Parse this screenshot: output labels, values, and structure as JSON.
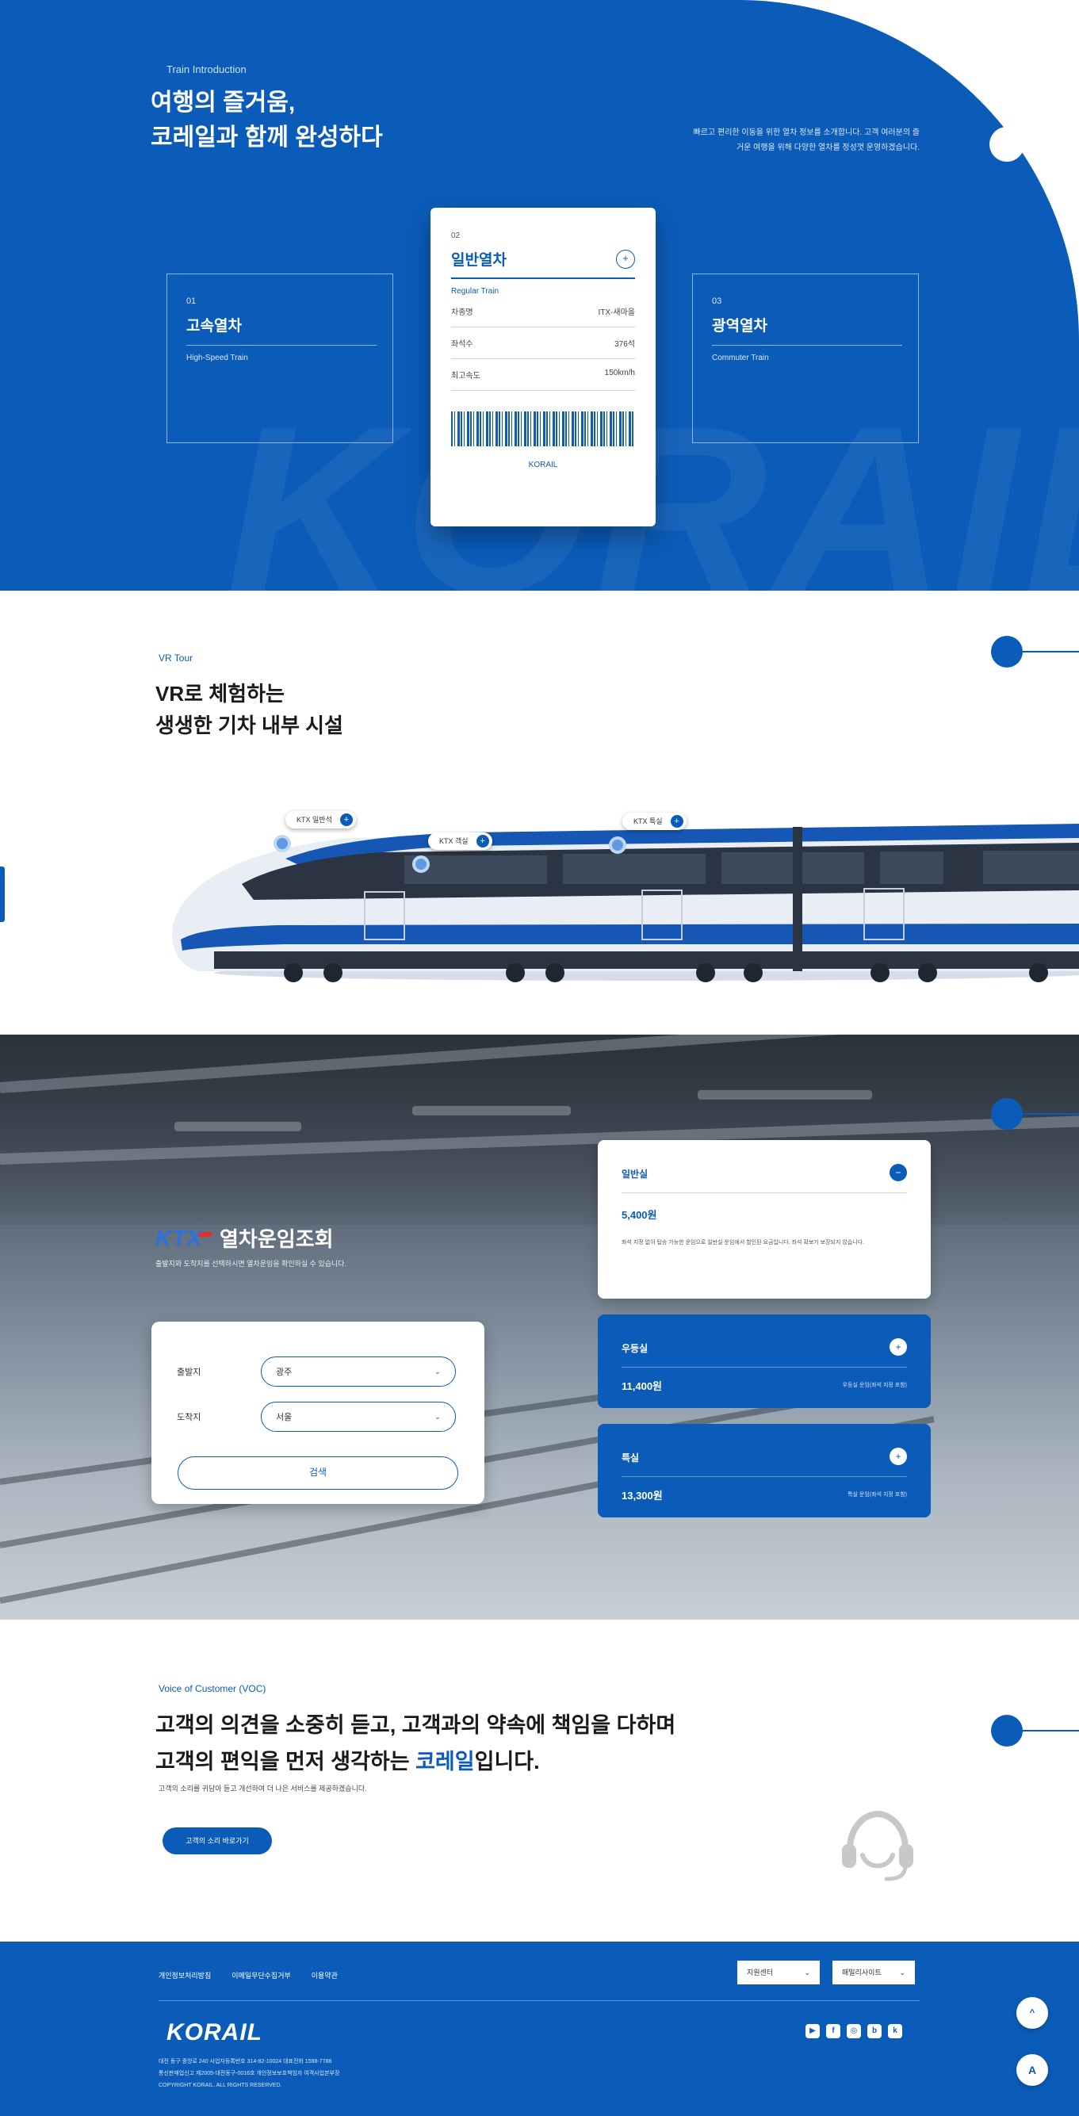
{
  "intro": {
    "eyebrow": "Train Introduction",
    "title_line1": "여행의 즐거움,",
    "title_line2": "코레일과 함께 완성하다",
    "desc_line1": "빠르고 편리한 이동을 위한 열차 정보를 소개합니다. 고객 여러분의 즐",
    "desc_line2": "거운 여행을 위해 다양한 열차를 정성껏 운영하겠습니다.",
    "watermark": "KORAIL",
    "cards": [
      {
        "num": "01",
        "name": "고속열차",
        "en": "High-Speed Train"
      },
      {
        "num": "03",
        "name": "광역열차",
        "en": "Commuter Train"
      }
    ],
    "ticket": {
      "num": "02",
      "name": "일반열차",
      "en": "Regular Train",
      "specs": [
        {
          "label": "차종명",
          "value": "ITX-새마을"
        },
        {
          "label": "좌석수",
          "value": "376석"
        },
        {
          "label": "최고속도",
          "value": "150km/h"
        }
      ],
      "code": "KORAIL",
      "icon": "plus"
    }
  },
  "vr": {
    "eyebrow": "VR Tour",
    "title_line1": "VR로 체험하는",
    "title_line2": "생생한 기차 내부 시설",
    "hotspots": [
      {
        "label": "KTX 일반석"
      },
      {
        "label": "KTX 객실"
      },
      {
        "label": "KTX 특실"
      }
    ]
  },
  "kt": {
    "logo": "KTX",
    "title": "열차운임조회",
    "subtitle": "출발지와 도착지를 선택하시면 열차운임을 확인하실 수 있습니다.",
    "departure_label": "출발지",
    "departure_value": "광주",
    "arrival_label": "도착지",
    "arrival_value": "서울",
    "search_label": "검색",
    "fares": [
      {
        "title": "일반실",
        "price": "5,400원",
        "note": "좌석 지정 없이 탑승 가능한 운임으로 일반실 운임에서 할인된 요금입니다. 좌석 확보가 보장되지 않습니다."
      },
      {
        "title": "우등실",
        "price": "11,400원",
        "note": "우등실 운임(좌석 지정 포함)"
      },
      {
        "title": "특실",
        "price": "13,300원",
        "note": "특실 운임(좌석 지정 포함)"
      }
    ]
  },
  "voc": {
    "eyebrow": "Voice of Customer (VOC)",
    "title_line1": "고객의 의견을 소중히 듣고, 고객과의 약속에 책임을 다하며",
    "title_line2_a": "고객의 편익을 먼저 생각하는 ",
    "title_line2_hl": "코레일",
    "title_line2_b": "입니다.",
    "subtitle": "고객의 소리를 귀담아 듣고 개선하여 더 나은 서비스를 제공하겠습니다.",
    "button": "고객의 소리 바로가기"
  },
  "footer": {
    "links": [
      "개인정보처리방침",
      "이메일무단수집거부",
      "이용약관"
    ],
    "select1": "지원센터",
    "select2": "패밀리사이트",
    "logo": "KORAIL",
    "social": [
      "youtube-icon",
      "facebook-icon",
      "instagram-icon",
      "blog-icon",
      "kakao-icon"
    ],
    "info_line1": "대전 동구 중앙로 240  사업자등록번호 314-82-10024  대표전화 1588-7788",
    "info_line2": "통신판매업신고 제2005-대전동구-0016호  개인정보보호책임자 여객사업본부장",
    "info_line3": "COPYRIGHT KORAIL. ALL RIGHTS RESERVED."
  },
  "float": {
    "top_label": "^",
    "chat_label": "A"
  },
  "colors": {
    "brand": "#0b5cb8",
    "ktx_red": "#e03030"
  }
}
